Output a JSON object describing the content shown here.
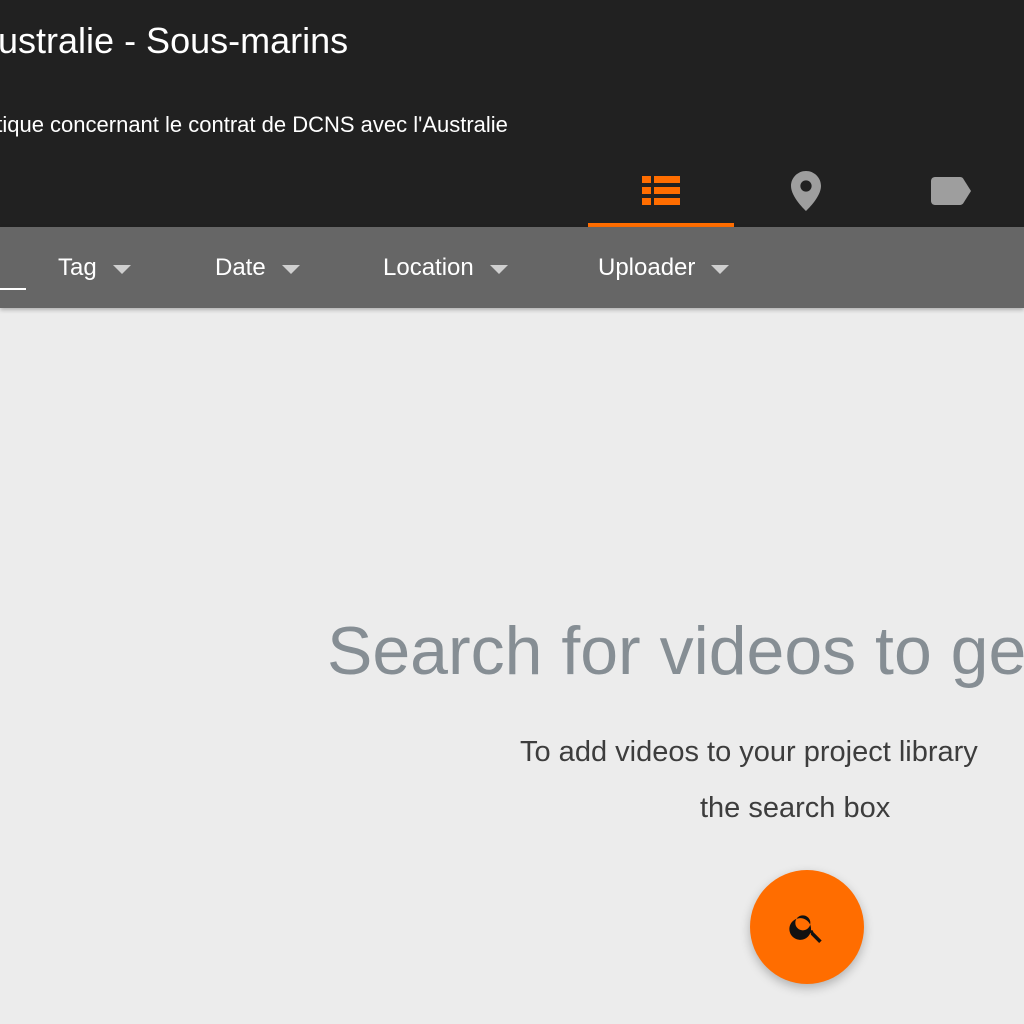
{
  "project": {
    "title": "Australie - Sous-marins",
    "description": "atique concernant le contrat de DCNS avec l'Australie"
  },
  "view_tabs": [
    {
      "name": "list",
      "icon": "list-view-icon",
      "active": true
    },
    {
      "name": "map",
      "icon": "map-marker-icon",
      "active": false
    },
    {
      "name": "tags",
      "icon": "tag-icon",
      "active": false
    }
  ],
  "filters": {
    "tag_label": "Tag",
    "date_label": "Date",
    "location_label": "Location",
    "uploader_label": "Uploader"
  },
  "empty_state": {
    "heading": "Search for videos to ge",
    "line1": "To add videos to your project library",
    "line2": "the search box"
  },
  "fab": {
    "icon": "search-icon"
  },
  "colors": {
    "header_bg": "#212121",
    "filter_bar_bg": "#666666",
    "accent": "#ff6d00",
    "page_bg": "#ececec",
    "inactive_icon": "#9e9e9e"
  }
}
